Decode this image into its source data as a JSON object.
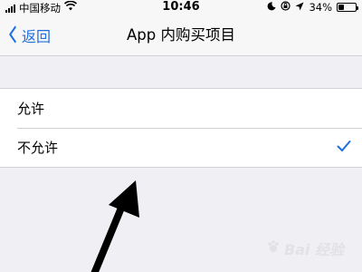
{
  "status_bar": {
    "carrier": "中国移动",
    "time": "10:46",
    "battery_text": "34%",
    "battery_level": 0.34,
    "icons": [
      "signal-icon",
      "wifi-icon",
      "moon-icon",
      "rotation-lock-icon",
      "location-icon",
      "battery-icon"
    ]
  },
  "nav": {
    "back_label": "返回",
    "title": "App 内购买项目"
  },
  "options": [
    {
      "label": "允许",
      "selected": false
    },
    {
      "label": "不允许",
      "selected": true
    }
  ],
  "watermark": {
    "text": "Bai 经验"
  },
  "colors": {
    "accent": "#1e6fe0",
    "background": "#efeff4",
    "bar": "#f7f7f7"
  }
}
